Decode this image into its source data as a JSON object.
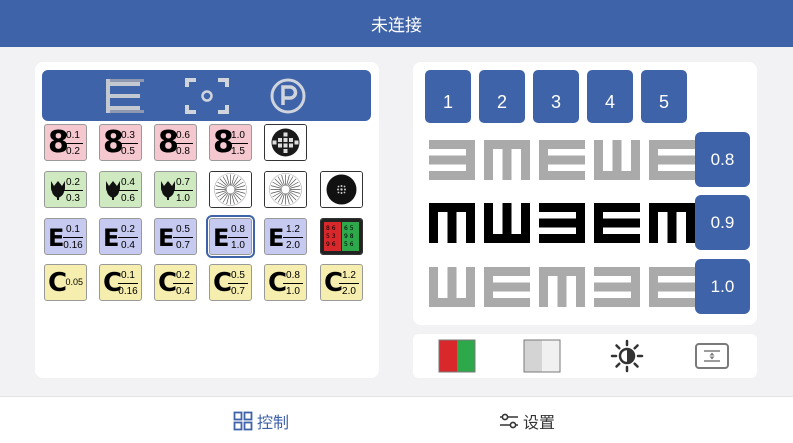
{
  "header": {
    "title": "未连接"
  },
  "mode_bar": [
    {
      "icon": "e-chart-icon"
    },
    {
      "icon": "projector-icon"
    },
    {
      "icon": "polarized-icon"
    }
  ],
  "chart_grid": {
    "rows": [
      [
        {
          "glyph": "8",
          "top": "0.1",
          "bottom": "0.2",
          "color": "pink"
        },
        {
          "glyph": "8",
          "top": "0.3",
          "bottom": "0.5",
          "color": "pink"
        },
        {
          "glyph": "8",
          "top": "0.6",
          "bottom": "0.8",
          "color": "pink"
        },
        {
          "glyph": "8",
          "top": "1.0",
          "bottom": "1.5",
          "color": "pink"
        },
        {
          "icon": "cross-grid-icon",
          "color": "white"
        }
      ],
      [
        {
          "icon": "tulip-icon",
          "top": "0.2",
          "bottom": "0.3",
          "color": "green"
        },
        {
          "icon": "tulip-icon",
          "top": "0.4",
          "bottom": "0.6",
          "color": "green"
        },
        {
          "icon": "tulip-icon",
          "top": "0.7",
          "bottom": "1.0",
          "color": "green"
        },
        {
          "icon": "astigmatism-fan-icon",
          "color": "white"
        },
        {
          "icon": "astigmatism-fan-icon",
          "color": "white"
        },
        {
          "icon": "dot-target-icon",
          "color": "white"
        }
      ],
      [
        {
          "glyph": "E",
          "top": "0.1",
          "bottom": "0.16",
          "color": "blue"
        },
        {
          "glyph": "E",
          "top": "0.2",
          "bottom": "0.4",
          "color": "blue"
        },
        {
          "glyph": "E",
          "top": "0.5",
          "bottom": "0.7",
          "color": "blue"
        },
        {
          "glyph": "E",
          "top": "0.8",
          "bottom": "1.0",
          "color": "blue",
          "selected": true
        },
        {
          "glyph": "E",
          "top": "1.2",
          "bottom": "2.0",
          "color": "blue"
        },
        {
          "icon": "red-green-test-icon",
          "color": "white"
        }
      ],
      [
        {
          "glyph": "C",
          "single": "0.05",
          "color": "yellow"
        },
        {
          "glyph": "C",
          "top": "0.1",
          "bottom": "0.16",
          "color": "yellow"
        },
        {
          "glyph": "C",
          "top": "0.2",
          "bottom": "0.4",
          "color": "yellow"
        },
        {
          "glyph": "C",
          "top": "0.5",
          "bottom": "0.7",
          "color": "yellow"
        },
        {
          "glyph": "C",
          "top": "0.8",
          "bottom": "1.0",
          "color": "yellow"
        },
        {
          "glyph": "C",
          "top": "1.2",
          "bottom": "2.0",
          "color": "yellow"
        }
      ]
    ]
  },
  "line_buttons": [
    "1",
    "2",
    "3",
    "4",
    "5"
  ],
  "optotype_rows": [
    {
      "dirs": [
        "left",
        "down",
        "right",
        "up",
        "right"
      ],
      "color": "#aaaaaa"
    },
    {
      "dirs": [
        "down",
        "up",
        "left",
        "right",
        "down"
      ],
      "color": "#000000"
    },
    {
      "dirs": [
        "up",
        "right",
        "down",
        "left",
        "right"
      ],
      "color": "#aaaaaa"
    }
  ],
  "acuity_buttons": [
    "0.8",
    "0.9",
    "1.0"
  ],
  "tools": [
    {
      "icon": "red-green-icon"
    },
    {
      "icon": "gray-split-icon"
    },
    {
      "icon": "brightness-icon"
    },
    {
      "icon": "adjust-icon"
    }
  ],
  "bottom_nav": {
    "control_label": "控制",
    "settings_label": "设置",
    "active": "control"
  },
  "colors": {
    "accent": "#3f63a8",
    "pink": "#f5c7cf",
    "green": "#cfeac0",
    "blue": "#c6caf0",
    "yellow": "#f6eeae"
  }
}
